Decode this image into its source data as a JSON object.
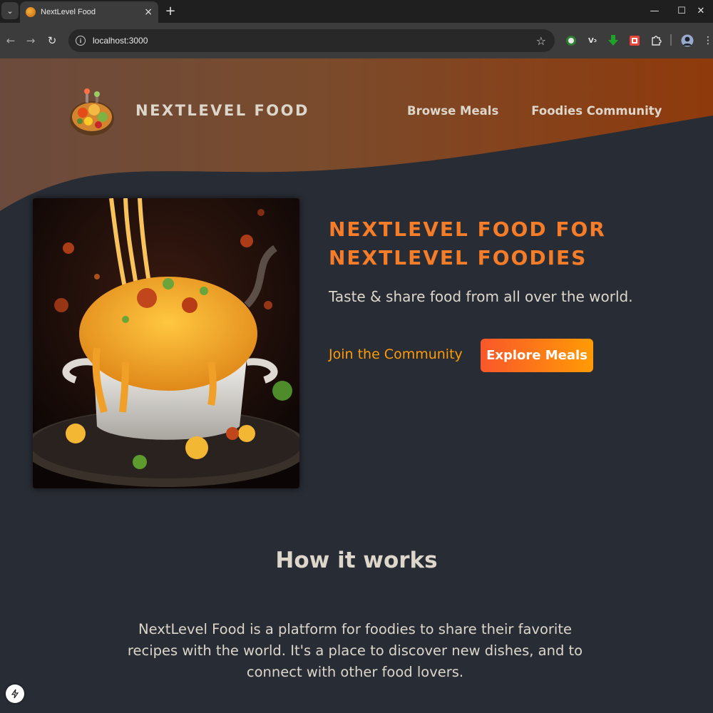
{
  "browser": {
    "tab_title": "NextLevel Food",
    "url": "localhost:3000",
    "new_tab_symbol": "+",
    "close_symbol": "×"
  },
  "header": {
    "logo_text": "NEXTLEVEL FOOD",
    "nav": [
      {
        "label": "Browse Meals"
      },
      {
        "label": "Foodies Community"
      }
    ]
  },
  "hero": {
    "heading_line1": "NEXTLEVEL FOOD FOR",
    "heading_line2": "NEXTLEVEL FOODIES",
    "subtitle": "Taste & share food from all over the world.",
    "join_label": "Join the Community",
    "explore_label": "Explore Meals"
  },
  "how_it_works": {
    "title": "How it works",
    "description": "NextLevel Food is a platform for foodies to share their favorite recipes with the world. It's a place to discover new dishes, and to connect with other food lovers."
  },
  "colors": {
    "page_bg": "#282c34",
    "accent_orange": "#f57c28",
    "link_orange": "#ff9b05",
    "button_gradient_start": "#f9572a",
    "button_gradient_end": "#ff9b05",
    "text_light": "#ddd6cb",
    "header_brown": "#7a4a2e"
  }
}
